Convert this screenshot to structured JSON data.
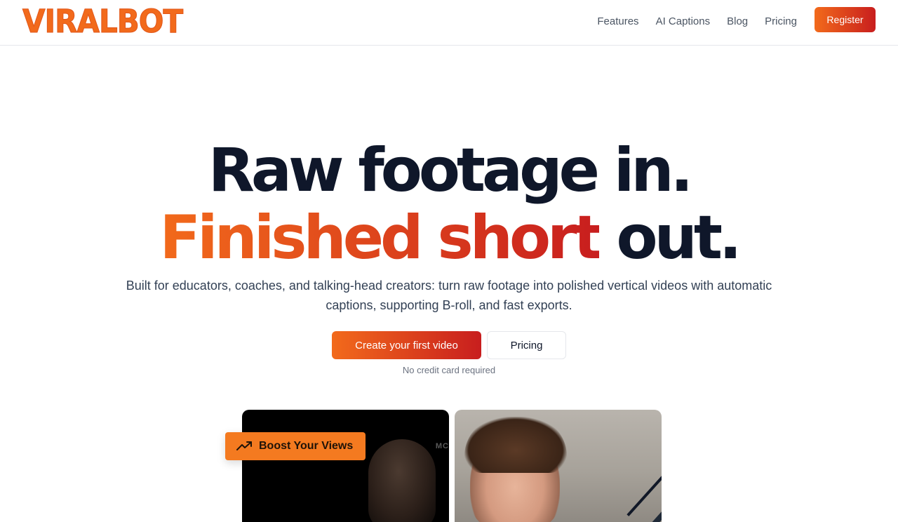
{
  "brand": {
    "logo_text": "VIRALBOT",
    "accent_start": "#f26a1b",
    "accent_end": "#c81e1e"
  },
  "nav": {
    "links": [
      "Features",
      "AI Captions",
      "Blog",
      "Pricing"
    ],
    "register_label": "Register"
  },
  "hero": {
    "line1": "Raw footage in.",
    "line2_highlight": "Finished short",
    "line2_rest": " out.",
    "subtitle": "Built for educators, coaches, and talking-head creators: turn raw footage into polished vertical videos with automatic captions, supporting B-roll, and fast exports.",
    "cta_primary": "Create your first video",
    "cta_secondary": "Pricing",
    "note": "No credit card required"
  },
  "badge": {
    "label": "Boost Your Views",
    "icon": "trending-up-icon"
  },
  "videos": [
    {
      "overlay_text": "MC",
      "icon": "video-thumbnail"
    },
    {
      "icon": "video-thumbnail"
    }
  ]
}
